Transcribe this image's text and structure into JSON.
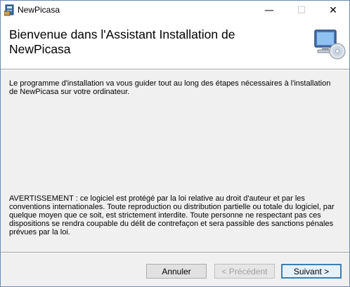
{
  "window": {
    "title": "NewPicasa",
    "minimize_glyph": "—",
    "maximize_glyph": "☐",
    "close_glyph": "✕"
  },
  "header": {
    "title": "Bienvenue dans l'Assistant Installation de NewPicasa",
    "icon": "computer-cd-icon"
  },
  "body": {
    "intro": "Le programme d'installation va vous guider tout au long des étapes nécessaires à l'installation de NewPicasa sur votre ordinateur.",
    "warning": "AVERTISSEMENT : ce logiciel est protégé par la loi relative au droit d'auteur et par les conventions internationales. Toute reproduction ou distribution partielle ou totale du logiciel, par quelque moyen que ce soit, est strictement interdite. Toute personne ne respectant pas ces dispositions se rendra coupable du délit de contrefaçon et sera passible des sanctions pénales prévues par la loi."
  },
  "buttons": {
    "cancel": "Annuler",
    "previous": "< Précédent",
    "next": "Suivant >"
  },
  "colors": {
    "accent": "#3c7fb1",
    "window_border": "#6b8bb3"
  }
}
